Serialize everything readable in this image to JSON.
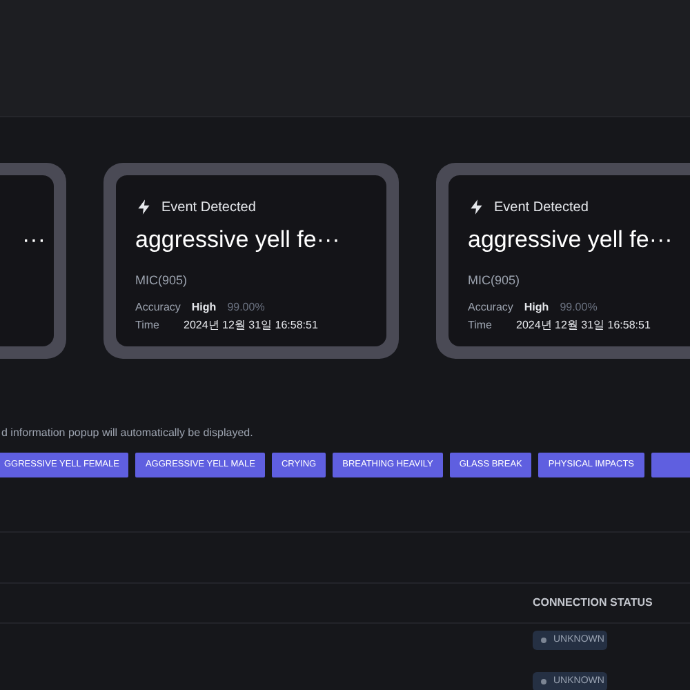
{
  "cards": [
    {
      "title": "···"
    },
    {
      "header": "Event Detected",
      "title": "aggressive yell fe···",
      "source": "MIC(905)",
      "accuracy_label": "Accuracy",
      "accuracy_level": "High",
      "accuracy_value": "99.00%",
      "time_label": "Time",
      "time": "2024년 12월 31일 16:58:51"
    },
    {
      "header": "Event Detected",
      "title": "aggressive yell fe···",
      "source": "MIC(905)",
      "accuracy_label": "Accuracy",
      "accuracy_level": "High",
      "accuracy_value": "99.00%",
      "time_label": "Time",
      "time": "2024년 12월 31일 16:58:51"
    }
  ],
  "notice": "d information popup will automatically be displayed.",
  "chips": [
    "GGRESSIVE YELL FEMALE",
    "AGGRESSIVE YELL MALE",
    "CRYING",
    "BREATHING HEAVILY",
    "GLASS BREAK",
    "PHYSICAL IMPACTS"
  ],
  "more_chip_visible": true,
  "table": {
    "column": "CONNECTION STATUS",
    "statuses": [
      "UNKNOWN",
      "UNKNOWN"
    ]
  }
}
